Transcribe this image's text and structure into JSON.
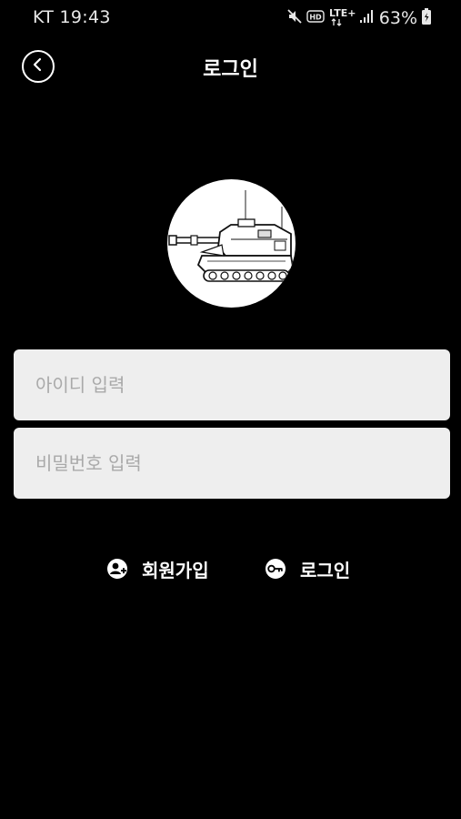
{
  "status_bar": {
    "carrier_time": "KT 19:43",
    "network": "LTE+",
    "battery": "63%",
    "icons": [
      "mute-icon",
      "hd-icon",
      "lte-icon",
      "signal-icon",
      "battery-icon"
    ]
  },
  "header": {
    "title": "로그인",
    "back_icon": "chevron-left-icon"
  },
  "logo": {
    "icon": "tank-icon"
  },
  "form": {
    "id_placeholder": "아이디 입력",
    "id_value": "",
    "password_placeholder": "비밀번호 입력",
    "password_value": ""
  },
  "actions": {
    "signup_label": "회원가입",
    "signup_icon": "user-add-icon",
    "login_label": "로그인",
    "login_icon": "key-icon"
  },
  "colors": {
    "background": "#000000",
    "text": "#ffffff",
    "input_background": "#eeeeee",
    "placeholder": "#a9a9a9"
  }
}
